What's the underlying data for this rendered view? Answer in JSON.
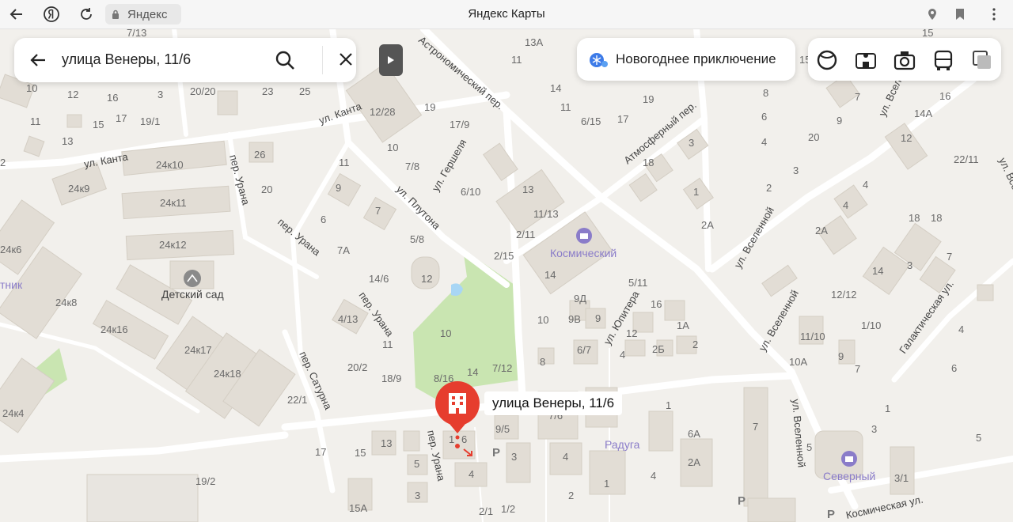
{
  "browser": {
    "tab_label": "Яндекс",
    "page_title": "Яндекс Карты",
    "icons": [
      "back-arrow-icon",
      "yandex-logo-icon",
      "reload-icon",
      "lock-icon",
      "location-icon",
      "bookmark-icon",
      "more-icon"
    ]
  },
  "search": {
    "query": "улица Венеры, 11/6",
    "icons": [
      "back-arrow-icon",
      "search-icon",
      "close-icon"
    ]
  },
  "promo": {
    "label": "Новогоднее приключение",
    "icon": "snowflake-globe-icon"
  },
  "layers": {
    "icons": [
      "map-layer-icon",
      "panorama-icon",
      "camera-icon",
      "bus-icon",
      "layers-icon"
    ]
  },
  "selected_place": {
    "label": "улица Венеры, 11/6",
    "pin_color": "#e63d2e",
    "icon": "building-icon"
  },
  "streets": [
    "ул. Канта",
    "ул. Канта",
    "Астрономический пер.",
    "ул. Гершеля",
    "ул. Плутона",
    "Атмосферный пер.",
    "пер. Урана",
    "пер. Урана",
    "пер. Урана",
    "пер. Сатурна",
    "пер. Урана",
    "ул. Юпитера",
    "ул. Вселенной",
    "ул. Вселенной",
    "ул. Вселенной",
    "ул. Вселенной",
    "Галактическая ул.",
    "Космическая ул.",
    "ул. Вселенной"
  ],
  "pois": [
    "Детский сад",
    "Космический",
    "Радуга",
    "Северный",
    "тник"
  ],
  "house_numbers": [
    "7/13",
    "15",
    "13А",
    "15",
    "10",
    "12",
    "16",
    "3",
    "20/20",
    "23",
    "25",
    "11",
    "14",
    "8",
    "11",
    "15",
    "17",
    "19/1",
    "12/28",
    "19",
    "17/9",
    "11",
    "19",
    "6/15",
    "17",
    "7",
    "16",
    "14А",
    "13",
    "26",
    "10",
    "7/8",
    "9",
    "3",
    "4",
    "12",
    "2",
    "20",
    "11",
    "9",
    "18",
    "6",
    "24к10",
    "24к9",
    "24к11",
    "24к12",
    "20",
    "6/10",
    "13",
    "1",
    "2",
    "18",
    "3",
    "4",
    "11/13",
    "2/11",
    "7",
    "4",
    "22/11",
    "6",
    "7А",
    "5/8",
    "2/15",
    "2А",
    "18",
    "2А",
    "24к6",
    "14/6",
    "12",
    "14",
    "7",
    "14",
    "3",
    "24к8",
    "5/11",
    "9Д",
    "12/12",
    "24к16",
    "4/13",
    "10",
    "9В",
    "9",
    "16",
    "1А",
    "1/10",
    "24к17",
    "11",
    "10",
    "12",
    "4",
    "2Б",
    "2",
    "11/10",
    "24к18",
    "6/7",
    "9",
    "7",
    "20/2",
    "18/9",
    "8/16",
    "14",
    "7/12",
    "8",
    "10А",
    "6",
    "22/1",
    "1",
    "7",
    "7/6",
    "1",
    "5",
    "24к4",
    "1",
    "6",
    "9/5",
    "6А",
    "3",
    "5",
    "17",
    "15",
    "13",
    "3",
    "4",
    "2А",
    "3/1",
    "5",
    "4",
    "4",
    "19/2",
    "1",
    "3",
    "15А",
    "2/1",
    "1/2",
    "2",
    "4"
  ],
  "colors": {
    "background": "#f2f0ec",
    "building": "#e2ddd5",
    "road": "#ffffff",
    "park": "#c9e5b1",
    "water": "#a8d6f5",
    "pin": "#e63d2e"
  }
}
